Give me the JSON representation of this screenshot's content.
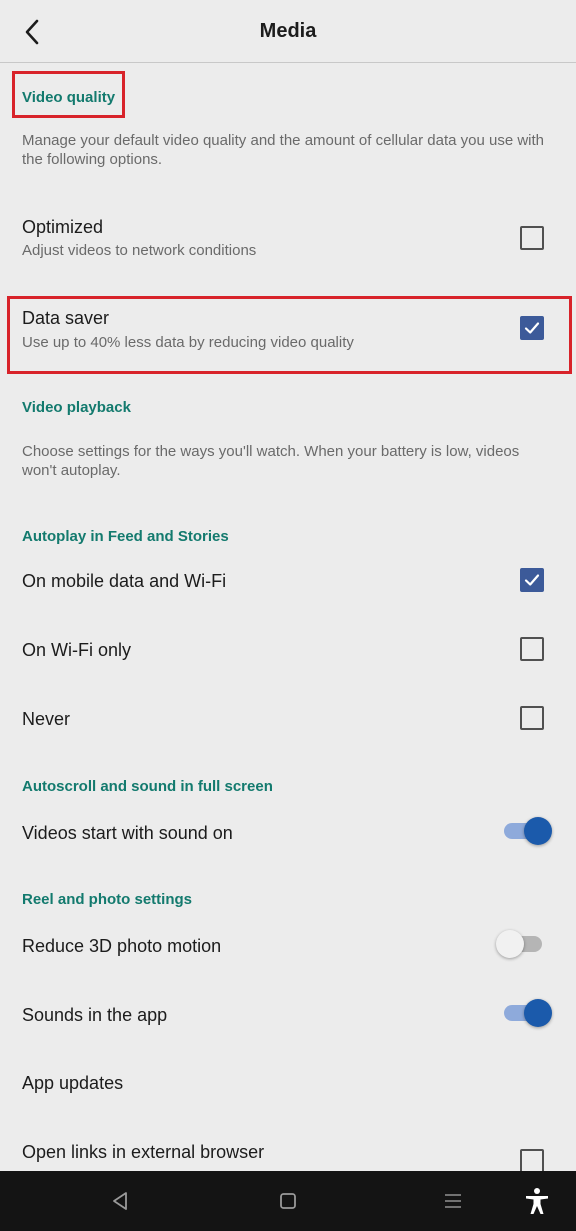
{
  "header": {
    "title": "Media",
    "back_icon": "chevron-left-icon"
  },
  "sections": {
    "video_quality": {
      "title": "Video quality",
      "description": "Manage your default video quality and the amount of cellular data you use with the following options.",
      "options": [
        {
          "label": "Optimized",
          "sublabel": "Adjust videos to network conditions",
          "checked": false
        },
        {
          "label": "Data saver",
          "sublabel": "Use up to 40% less data by reducing video quality",
          "checked": true
        }
      ]
    },
    "video_playback": {
      "title": "Video playback",
      "description": "Choose settings for the ways you'll watch. When your battery is low, videos won't autoplay."
    },
    "autoplay": {
      "title": "Autoplay in Feed and Stories",
      "options": [
        {
          "label": "On mobile data and Wi-Fi",
          "checked": true
        },
        {
          "label": "On Wi-Fi only",
          "checked": false
        },
        {
          "label": "Never",
          "checked": false
        }
      ]
    },
    "autoscroll": {
      "title": "Autoscroll and sound in full screen",
      "options": [
        {
          "label": "Videos start with sound on",
          "enabled": true
        }
      ]
    },
    "reel_photo": {
      "title": "Reel and photo settings",
      "options": [
        {
          "label": "Reduce 3D photo motion",
          "enabled": false
        },
        {
          "label": "Sounds in the app",
          "enabled": true
        },
        {
          "label": "App updates"
        },
        {
          "label": "Open links in external browser",
          "checked": false
        }
      ]
    }
  },
  "colors": {
    "accent_teal": "#137a6e",
    "checkbox_blue": "#3c5a99",
    "toggle_on": "#1b5aab",
    "highlight_red": "#d8232a"
  },
  "navbar": {
    "icons": [
      "back-triangle-icon",
      "home-square-icon",
      "menu-lines-icon",
      "accessibility-icon"
    ]
  }
}
